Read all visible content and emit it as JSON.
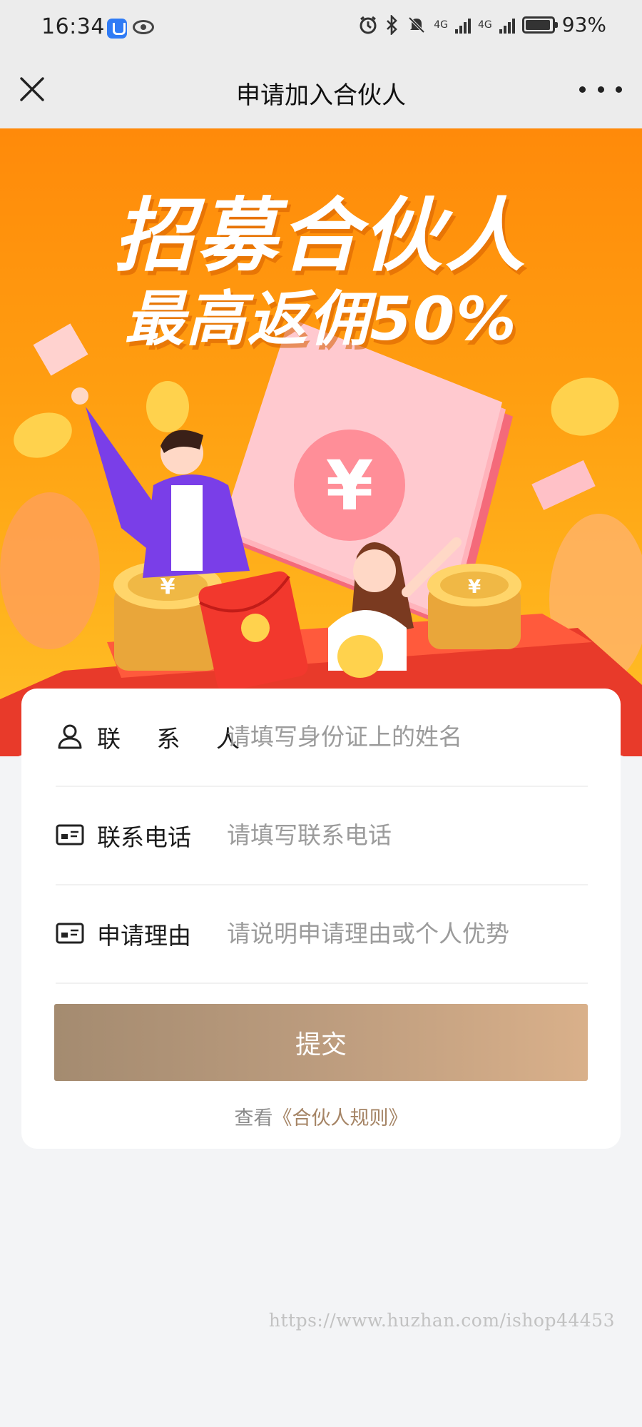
{
  "status_bar": {
    "time": "16:34",
    "network_1": "4G",
    "network_2": "4G",
    "battery_percent": "93%",
    "icons": [
      "app-shield-icon",
      "eye-icon",
      "alarm-icon",
      "bluetooth-icon",
      "mute-icon",
      "signal-icon",
      "battery-icon"
    ]
  },
  "nav": {
    "title": "申请加入合伙人",
    "close_icon": "close-icon",
    "more_icon": "more-icon"
  },
  "banner": {
    "headline": "招募合伙人",
    "subheadline": "最高返佣50%",
    "currency_symbol": "¥",
    "colors": {
      "top": "#ff8a0a",
      "bottom": "#ffc12a",
      "text_shadow": "#d65c00"
    }
  },
  "form": {
    "fields": [
      {
        "label": "联 系 人",
        "placeholder": "请填写身份证上的姓名",
        "value": "",
        "icon": "person-icon"
      },
      {
        "label": "联系电话",
        "placeholder": "请填写联系电话",
        "value": "",
        "icon": "id-card-icon"
      },
      {
        "label": "申请理由",
        "placeholder": "请说明申请理由或个人优势",
        "value": "",
        "icon": "id-card-icon"
      }
    ],
    "submit_label": "提交",
    "rules_prefix": "查看",
    "rules_link": "《合伙人规则》",
    "accent_color": "#a58465"
  },
  "watermark": "https://www.huzhan.com/ishop44453"
}
